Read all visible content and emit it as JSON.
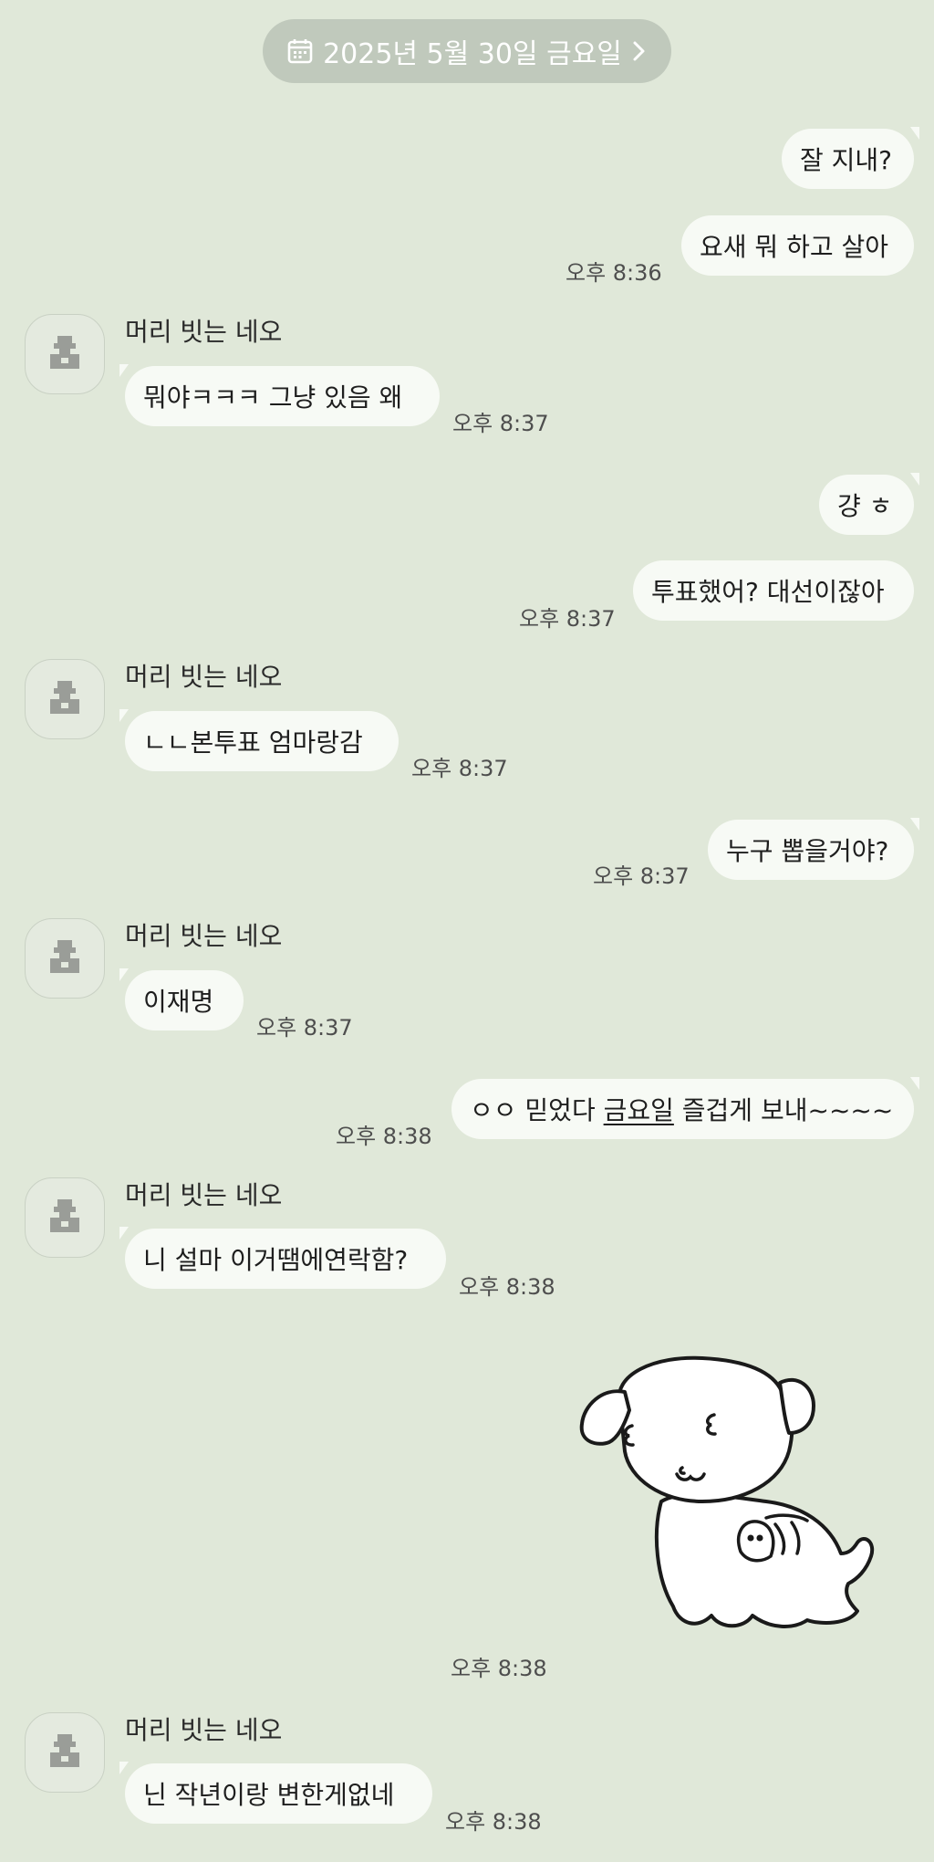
{
  "date_header": {
    "label": "2025년 5월 30일 금요일",
    "icon": "calendar-icon",
    "chevron": "chevron-right-icon"
  },
  "sender_name": "머리 빗는 네오",
  "messages": [
    {
      "side": "me",
      "text": "잘 지내?"
    },
    {
      "side": "me",
      "text": "요새 뭐 하고 살아",
      "time": "오후 8:36"
    },
    {
      "side": "other",
      "text": "뭐야ㅋㅋㅋ 그냥 있음 왜",
      "time": "오후 8:37"
    },
    {
      "side": "me",
      "text": "걍 ㅎ"
    },
    {
      "side": "me",
      "text": "투표했어? 대선이잖아",
      "time": "오후 8:37"
    },
    {
      "side": "other",
      "text": "ㄴㄴ본투표 엄마랑감",
      "time": "오후 8:37"
    },
    {
      "side": "me",
      "text": "누구 뽑을거야?",
      "time": "오후 8:37"
    },
    {
      "side": "other",
      "text": "이재명",
      "time": "오후 8:37"
    },
    {
      "side": "me",
      "text_before": "ㅇㅇ 믿었다 ",
      "text_link": "금요일",
      "text_after": " 즐겁게 보내~~~~",
      "time": "오후 8:38"
    },
    {
      "side": "other",
      "text": "니 설마 이거땜에연락함?",
      "time": "오후 8:38"
    },
    {
      "side": "me",
      "sticker": "puppy-sticker",
      "time": "오후 8:38"
    },
    {
      "side": "other",
      "text": "닌 작년이랑 변한게없네",
      "time": "오후 8:38"
    }
  ]
}
